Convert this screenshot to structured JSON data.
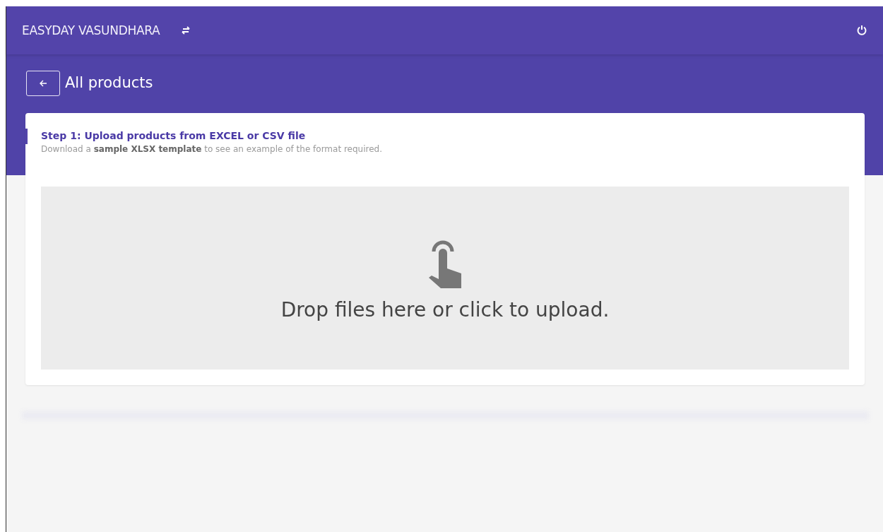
{
  "header": {
    "brand": "EASYDAY VASUNDHARA"
  },
  "page": {
    "title": "All products"
  },
  "step": {
    "title": "Step 1: Upload products from EXCEL or CSV file",
    "description": "Download a **sample XLSX template** to see an example of the format required."
  },
  "dropzone": {
    "message": "Drop files here or click to upload."
  }
}
